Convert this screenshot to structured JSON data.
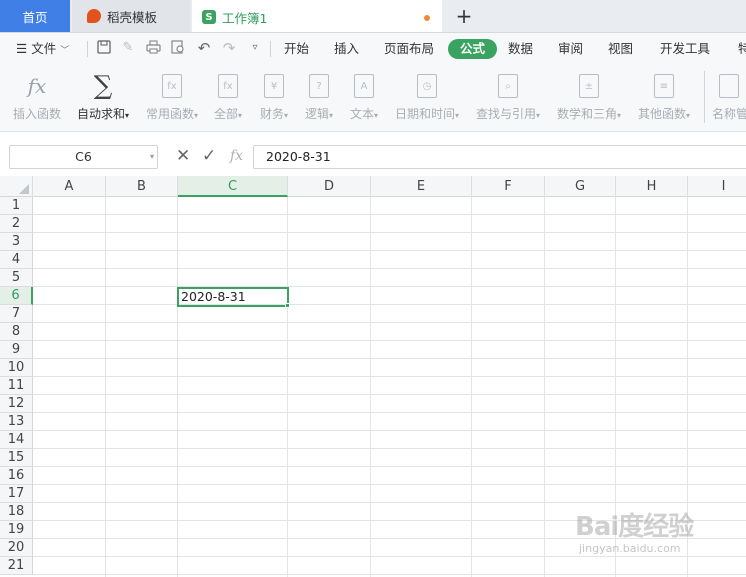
{
  "tabs": {
    "home": "首页",
    "template": "稻壳模板",
    "workbook": "工作簿1",
    "workbook_icon": "S",
    "unsaved_color": "#f08a3a",
    "new_tab": "+"
  },
  "menu": {
    "file": "文件",
    "items": [
      "开始",
      "插入",
      "页面布局",
      "公式",
      "数据",
      "审阅",
      "视图",
      "开发工具",
      "特"
    ],
    "active": "公式",
    "active_color": "#3aa35f"
  },
  "ribbon": {
    "buttons": [
      {
        "label": "插入函数",
        "icon": "fx-icon"
      },
      {
        "label": "自动求和",
        "icon": "sum-icon"
      },
      {
        "label": "常用函数",
        "icon": "common-functions-icon"
      },
      {
        "label": "全部",
        "icon": "all-functions-icon"
      },
      {
        "label": "财务",
        "icon": "finance-icon",
        "glyph": "¥"
      },
      {
        "label": "逻辑",
        "icon": "logic-icon",
        "glyph": "?"
      },
      {
        "label": "文本",
        "icon": "text-icon",
        "glyph": "A"
      },
      {
        "label": "日期和时间",
        "icon": "datetime-icon",
        "glyph": "◷"
      },
      {
        "label": "查找与引用",
        "icon": "lookup-icon",
        "glyph": "⌕"
      },
      {
        "label": "数学和三角",
        "icon": "math-icon",
        "glyph": "±"
      },
      {
        "label": "其他函数",
        "icon": "other-functions-icon",
        "glyph": "≡"
      },
      {
        "label": "名称管",
        "icon": "name-manager-icon"
      }
    ]
  },
  "formula_bar": {
    "name_box": "C6",
    "fx_label": "fx",
    "value": "2020-8-31"
  },
  "grid": {
    "columns": [
      "A",
      "B",
      "C",
      "D",
      "E",
      "F",
      "G",
      "H",
      "I"
    ],
    "rows": [
      "1",
      "2",
      "3",
      "4",
      "5",
      "6",
      "7",
      "8",
      "9",
      "10",
      "11",
      "12",
      "13",
      "14",
      "15",
      "16",
      "17",
      "18",
      "19",
      "20",
      "21"
    ],
    "selected_column": "C",
    "selected_row": "6",
    "active_cell_value": "2020-8-31"
  },
  "watermark": {
    "brand": "Bai度经验",
    "url": "jingyan.baidu.com"
  }
}
